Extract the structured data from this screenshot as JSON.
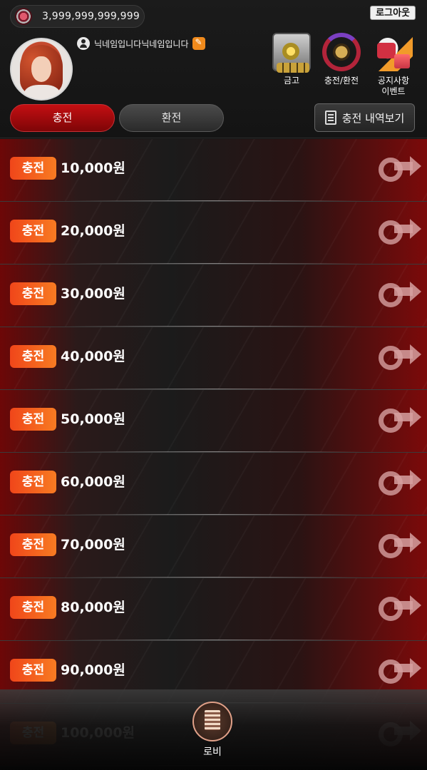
{
  "header": {
    "balance": "3,999,999,999,999",
    "logout_label": "로그아웃",
    "nickname": "닉네임입니다닉네임입니다"
  },
  "quick_menu": [
    {
      "label": "금고",
      "icon": "vault-icon"
    },
    {
      "label": "충전/환전",
      "icon": "exchange-icon"
    },
    {
      "label": "공지사항\n이벤트",
      "icon": "notice-icon"
    }
  ],
  "quick_labels": {
    "vault": "금고",
    "exchange": "충전/환전",
    "notice_line1": "공지사항",
    "notice_line2": "이벤트"
  },
  "tabs": {
    "charge": "충전",
    "exchange": "환전",
    "active": "charge"
  },
  "history_button": "충전 내역보기",
  "charge_items": [
    {
      "badge": "충전",
      "amount": "10,000원"
    },
    {
      "badge": "충전",
      "amount": "20,000원"
    },
    {
      "badge": "충전",
      "amount": "30,000원"
    },
    {
      "badge": "충전",
      "amount": "40,000원"
    },
    {
      "badge": "충전",
      "amount": "50,000원"
    },
    {
      "badge": "충전",
      "amount": "60,000원"
    },
    {
      "badge": "충전",
      "amount": "70,000원"
    },
    {
      "badge": "충전",
      "amount": "80,000원"
    },
    {
      "badge": "충전",
      "amount": "90,000원"
    },
    {
      "badge": "충전",
      "amount": "100,000원"
    }
  ],
  "bottom_nav": {
    "lobby_label": "로비"
  },
  "colors": {
    "accent_red": "#c40f12",
    "badge_orange": "#f0461a",
    "background": "#151515"
  }
}
